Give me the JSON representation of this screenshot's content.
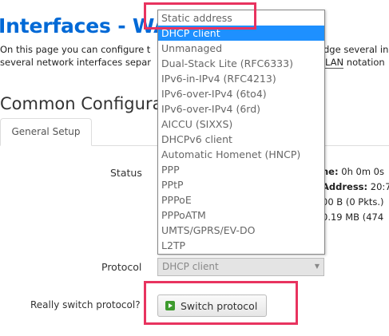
{
  "page": {
    "title": "Interfaces - WAN",
    "desc_line1_left": "On this page you can configure t",
    "desc_line1_right": "dge several in",
    "desc_line2_left": "several network interfaces separ",
    "desc_line2_right_underlined": "LAN",
    "desc_line2_right_rest": " notation",
    "section_title": "Common Configuratio"
  },
  "tabs": [
    {
      "label": "General Setup"
    }
  ],
  "status": {
    "label": "Status",
    "lines": [
      {
        "key": "ne:",
        "value": " 0h 0m 0s"
      },
      {
        "key": "Address:",
        "value": " 20:7"
      },
      {
        "key": "",
        "value": "00 B (0 Pkts.)"
      },
      {
        "key": "",
        "value": "0.19 MB (474"
      }
    ]
  },
  "protocol": {
    "label": "Protocol",
    "selected": "DHCP client",
    "options": [
      "Static address",
      "DHCP client",
      "Unmanaged",
      "Dual-Stack Lite (RFC6333)",
      "IPv6-in-IPv4 (RFC4213)",
      "IPv6-over-IPv4 (6to4)",
      "IPv6-over-IPv4 (6rd)",
      "AICCU (SIXXS)",
      "DHCPv6 client",
      "Automatic Homenet (HNCP)",
      "PPP",
      "PPtP",
      "PPPoE",
      "PPPoATM",
      "UMTS/GPRS/EV-DO",
      "L2TP"
    ],
    "highlighted_index": 1
  },
  "switch": {
    "question": "Really switch protocol?",
    "button_label": "Switch protocol"
  },
  "colors": {
    "title_blue": "#0069d6",
    "highlight_red": "#e8335f",
    "dropdown_selected": "#1e90ff",
    "button_icon_green": "#3e9b2e"
  }
}
